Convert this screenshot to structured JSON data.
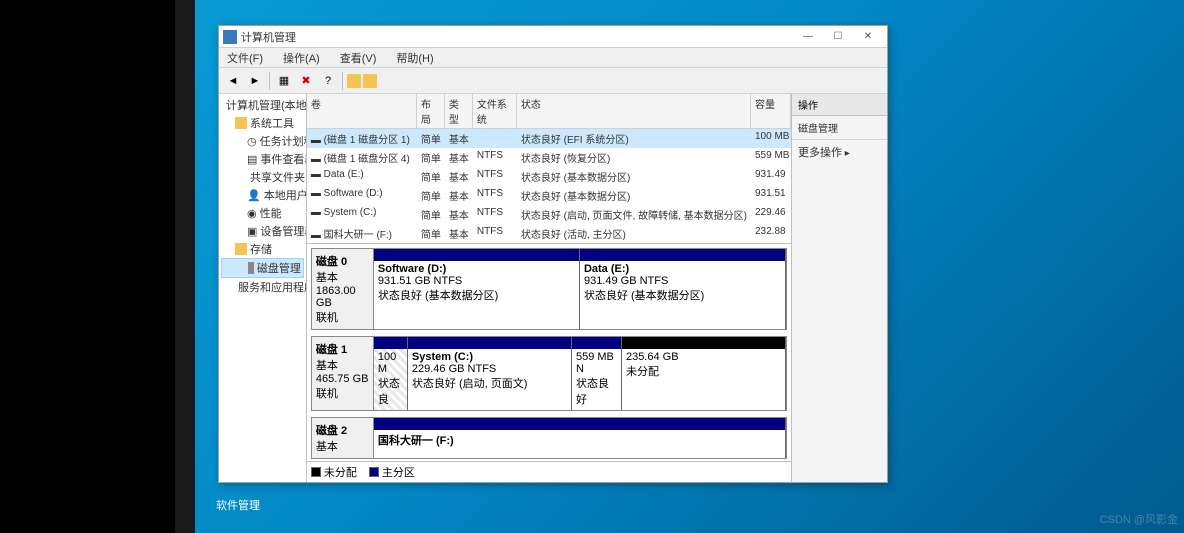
{
  "window": {
    "title": "计算机管理",
    "menu": [
      "文件(F)",
      "操作(A)",
      "查看(V)",
      "帮助(H)"
    ],
    "controls": {
      "min": "—",
      "max": "☐",
      "close": "✕"
    }
  },
  "tree": {
    "root": "计算机管理(本地)",
    "sys_tools": "系统工具",
    "task_scheduler": "任务计划程序",
    "event_viewer": "事件查看器",
    "shared_folders": "共享文件夹",
    "local_users": "本地用户和组",
    "performance": "性能",
    "device_mgr": "设备管理器",
    "storage": "存储",
    "disk_mgmt": "磁盘管理",
    "services_apps": "服务和应用程序"
  },
  "vol_headers": {
    "vol": "卷",
    "layout": "布局",
    "type": "类型",
    "fs": "文件系统",
    "status": "状态",
    "capacity": "容量"
  },
  "volumes": [
    {
      "name": "(磁盘 1 磁盘分区 1)",
      "layout": "简单",
      "type": "基本",
      "fs": "",
      "status": "状态良好 (EFI 系统分区)",
      "cap": "100 MB"
    },
    {
      "name": "(磁盘 1 磁盘分区 4)",
      "layout": "简单",
      "type": "基本",
      "fs": "NTFS",
      "status": "状态良好 (恢复分区)",
      "cap": "559 MB"
    },
    {
      "name": "Data (E:)",
      "layout": "简单",
      "type": "基本",
      "fs": "NTFS",
      "status": "状态良好 (基本数据分区)",
      "cap": "931.49"
    },
    {
      "name": "Software (D:)",
      "layout": "简单",
      "type": "基本",
      "fs": "NTFS",
      "status": "状态良好 (基本数据分区)",
      "cap": "931.51"
    },
    {
      "name": "System (C:)",
      "layout": "简单",
      "type": "基本",
      "fs": "NTFS",
      "status": "状态良好 (启动, 页面文件, 故障转储, 基本数据分区)",
      "cap": "229.46"
    },
    {
      "name": "国科大研一 (F:)",
      "layout": "简单",
      "type": "基本",
      "fs": "NTFS",
      "status": "状态良好 (活动, 主分区)",
      "cap": "232.88"
    }
  ],
  "disks": {
    "d0": {
      "label": "磁盘 0",
      "type": "基本",
      "size": "1863.00 GB",
      "state": "联机",
      "parts": [
        {
          "name": "Software (D:)",
          "info": "931.51 GB NTFS",
          "status": "状态良好 (基本数据分区)"
        },
        {
          "name": "Data (E:)",
          "info": "931.49 GB NTFS",
          "status": "状态良好 (基本数据分区)"
        }
      ]
    },
    "d1": {
      "label": "磁盘 1",
      "type": "基本",
      "size": "465.75 GB",
      "state": "联机",
      "parts": [
        {
          "name": "",
          "info": "100 M",
          "status": "状态良"
        },
        {
          "name": "System (C:)",
          "info": "229.46 GB NTFS",
          "status": "状态良好 (启动, 页面文)"
        },
        {
          "name": "",
          "info": "559 MB N",
          "status": "状态良好"
        },
        {
          "name": "",
          "info": "235.64 GB",
          "status": "未分配"
        }
      ]
    },
    "d2": {
      "label": "磁盘 2",
      "type": "基本",
      "parts": [
        {
          "name": "国科大研一 (F:)",
          "info": "",
          "status": ""
        }
      ]
    }
  },
  "legend": {
    "unalloc": "未分配",
    "primary": "主分区"
  },
  "actions": {
    "header": "操作",
    "disk_mgmt": "磁盘管理",
    "more": "更多操作"
  },
  "taskbar": "软件管理",
  "watermark": "CSDN @风影金"
}
